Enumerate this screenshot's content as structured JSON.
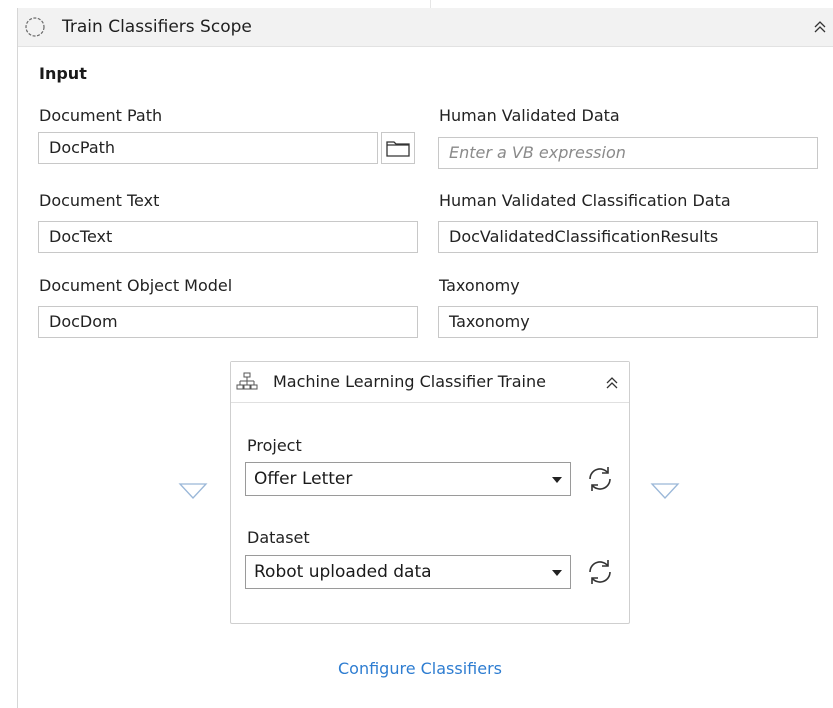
{
  "header": {
    "title": "Train Classifiers Scope"
  },
  "input_section": {
    "title": "Input",
    "document_path": {
      "label": "Document Path",
      "value": "DocPath"
    },
    "human_validated_data": {
      "label": "Human Validated Data",
      "placeholder": "Enter a VB expression"
    },
    "document_text": {
      "label": "Document Text",
      "value": "DocText"
    },
    "human_validated_classification_data": {
      "label": "Human Validated Classification Data",
      "value": "DocValidatedClassificationResults"
    },
    "document_object_model": {
      "label": "Document Object Model",
      "value": "DocDom"
    },
    "taxonomy": {
      "label": "Taxonomy",
      "value": "Taxonomy"
    }
  },
  "ml_trainer": {
    "title": "Machine Learning Classifier Traine",
    "project": {
      "label": "Project",
      "selected": "Offer Letter"
    },
    "dataset": {
      "label": "Dataset",
      "selected": "Robot uploaded data"
    }
  },
  "footer": {
    "configure_link": "Configure Classifiers"
  },
  "colors": {
    "link": "#2e7dd1",
    "header_bg": "#f2f2f2",
    "border": "#c8c8c8"
  },
  "icons": [
    "scope-icon",
    "collapse-icon",
    "folder-icon",
    "hierarchy-icon",
    "refresh-icon",
    "drop-triangle-icon"
  ]
}
